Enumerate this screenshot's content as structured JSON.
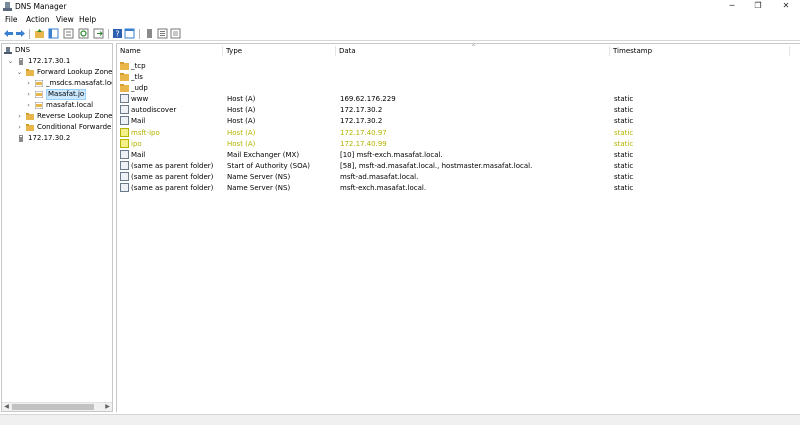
{
  "window": {
    "title": "DNS Manager",
    "minimize": "─",
    "maximize": "❐",
    "close": "✕"
  },
  "menu": [
    "File",
    "Action",
    "View",
    "Help"
  ],
  "tree": {
    "root": "DNS",
    "server1": "172.17.30.1",
    "forward": "Forward Lookup Zones",
    "msdcs": "_msdcs.masafat.local",
    "masafat_jo": "Masafat.jo",
    "masafat_local": "masafat.local",
    "reverse": "Reverse Lookup Zones",
    "conditional": "Conditional Forwarders",
    "server2": "172.17.30.2"
  },
  "columns": {
    "name": "Name",
    "type": "Type",
    "data": "Data",
    "timestamp": "Timestamp"
  },
  "rows": [
    {
      "name": "_tcp",
      "type": "",
      "data": "",
      "timestamp": "",
      "kind": "folder"
    },
    {
      "name": "_tls",
      "type": "",
      "data": "",
      "timestamp": "",
      "kind": "folder"
    },
    {
      "name": "_udp",
      "type": "",
      "data": "",
      "timestamp": "",
      "kind": "folder"
    },
    {
      "name": "www",
      "type": "Host (A)",
      "data": "169.62.176.229",
      "timestamp": "static",
      "kind": "record"
    },
    {
      "name": "autodiscover",
      "type": "Host (A)",
      "data": "172.17.30.2",
      "timestamp": "static",
      "kind": "record"
    },
    {
      "name": "Mail",
      "type": "Host (A)",
      "data": "172.17.30.2",
      "timestamp": "static",
      "kind": "record"
    },
    {
      "name": "msft-ipo",
      "type": "Host (A)",
      "data": "172.17.40.97",
      "timestamp": "static",
      "kind": "record",
      "dim": true
    },
    {
      "name": "ipo",
      "type": "Host (A)",
      "data": "172.17.40.99",
      "timestamp": "static",
      "kind": "record",
      "dim": true
    },
    {
      "name": "Mail",
      "type": "Mail Exchanger (MX)",
      "data": "[10]  msft-exch.masafat.local.",
      "timestamp": "static",
      "kind": "record"
    },
    {
      "name": "(same as parent folder)",
      "type": "Start of Authority (SOA)",
      "data": "[58], msft-ad.masafat.local., hostmaster.masafat.local.",
      "timestamp": "static",
      "kind": "record"
    },
    {
      "name": "(same as parent folder)",
      "type": "Name Server (NS)",
      "data": "msft-ad.masafat.local.",
      "timestamp": "static",
      "kind": "record"
    },
    {
      "name": "(same as parent folder)",
      "type": "Name Server (NS)",
      "data": "msft-exch.masafat.local.",
      "timestamp": "static",
      "kind": "record"
    }
  ],
  "colors": {
    "highlight": "#fefa4a",
    "dim_text": "#b3b300",
    "folder": "#e8b64a",
    "selected": "#cce8ff"
  },
  "icons": [
    "dns-icon",
    "server-icon",
    "folder-icon",
    "zone-icon",
    "record-icon"
  ]
}
